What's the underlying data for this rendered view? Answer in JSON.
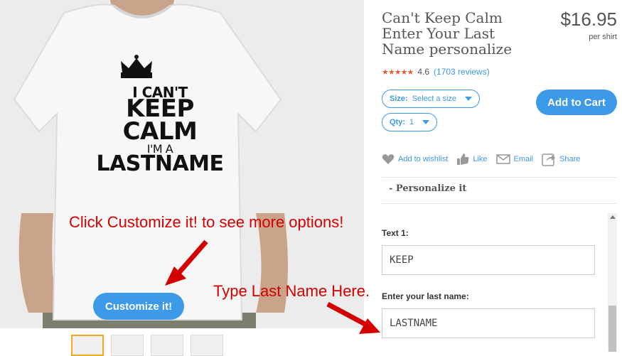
{
  "product": {
    "title": "Can't Keep Calm Enter Your Last Name personalize",
    "price": "$16.95",
    "price_unit": "per shirt",
    "rating": "4.6",
    "reviews": "(1703 reviews)",
    "top_cut_text": "…"
  },
  "shirt_print": {
    "line1": "I CAN'T",
    "line2": "KEEP",
    "line3": "CALM",
    "line4": "I'M A",
    "line5": "LASTNAME"
  },
  "annotations": {
    "customize_hint": "Click Customize it! to see more options!",
    "lastname_hint": "Type Last Name Here."
  },
  "buttons": {
    "customize": "Customize it!",
    "add_to_cart": "Add to Cart"
  },
  "options": {
    "size_label": "Size:",
    "size_value": "Select a size",
    "qty_label": "Qty:",
    "qty_value": "1"
  },
  "actions": {
    "wishlist": "Add to wishlist",
    "like": "Like",
    "email": "Email",
    "share": "Share"
  },
  "personalize": {
    "header": "- Personalize it",
    "text1_label": "Text 1:",
    "text1_value": "KEEP",
    "lastname_label": "Enter your last name:",
    "lastname_value": "LASTNAME"
  },
  "colors": {
    "accent": "#3d9ae8",
    "annotation": "#d40000",
    "star": "#e0623a"
  }
}
